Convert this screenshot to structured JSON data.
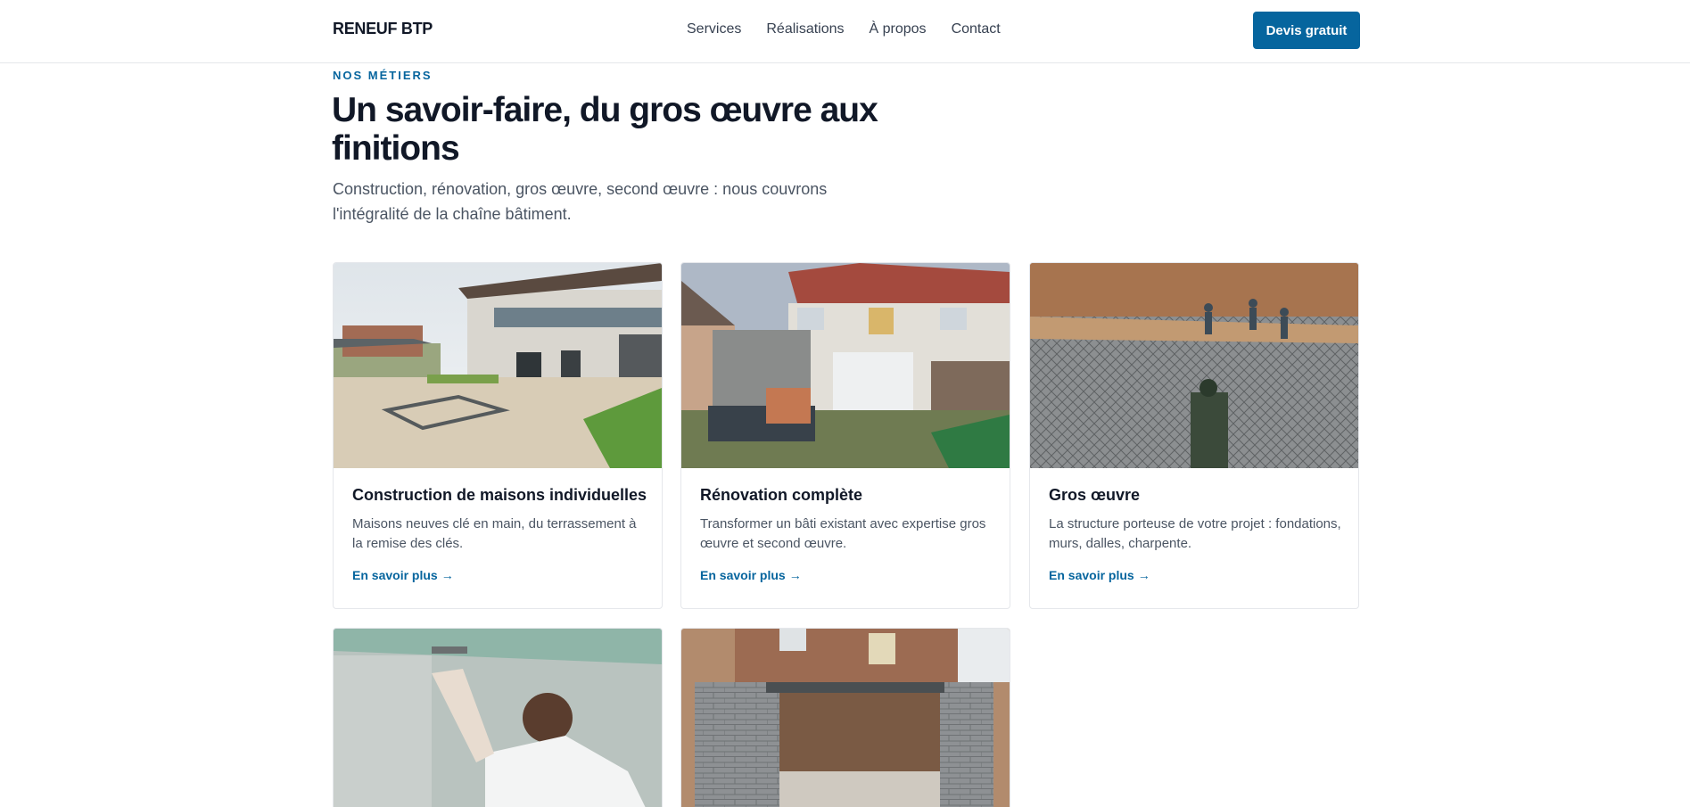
{
  "header": {
    "logo": "RENEUF BTP",
    "nav": [
      "Services",
      "Réalisations",
      "À propos",
      "Contact"
    ],
    "cta": "Devis gratuit"
  },
  "intro": {
    "eyebrow": "NOS MÉTIERS",
    "title": "Un savoir-faire, du gros œuvre aux finitions",
    "lead": "Construction, rénovation, gros œuvre, second œuvre : nous couvrons l'intégralité de la chaîne bâtiment."
  },
  "cards": [
    {
      "title": "Construction de maisons individuelles",
      "desc": "Maisons neuves clé en main, du terrassement à la remise des clés.",
      "link": "En savoir plus",
      "arrow": "→"
    },
    {
      "title": "Rénovation complète",
      "desc": "Transformer un bâti existant avec expertise gros œuvre et second œuvre.",
      "link": "En savoir plus",
      "arrow": "→"
    },
    {
      "title": "Gros œuvre",
      "desc": "La structure porteuse de votre projet : fondations, murs, dalles, charpente.",
      "link": "En savoir plus",
      "arrow": "→"
    }
  ],
  "theme": {
    "accent": "#06659e",
    "heading": "#111827",
    "body_text": "#4b5563",
    "border": "#e5e7eb"
  }
}
